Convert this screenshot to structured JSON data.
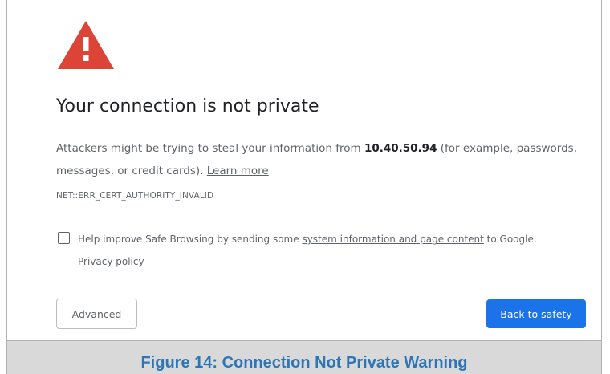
{
  "page": {
    "icon": "warning-triangle-icon",
    "title": "Your connection is not private",
    "message": {
      "before_host": "Attackers might be trying to steal your information from ",
      "host": "10.40.50.94",
      "after_host": " (for example, passwords, messages, or credit cards). ",
      "learn_more": "Learn more"
    },
    "error_code": "NET::ERR_CERT_AUTHORITY_INVALID",
    "safe_browsing": {
      "checked": false,
      "before_link": "Help improve Safe Browsing by sending some ",
      "link": "system information and page content",
      "after_link": " to Google. ",
      "privacy_link": "Privacy policy"
    },
    "buttons": {
      "advanced": "Advanced",
      "back_to_safety": "Back to safety"
    }
  },
  "caption": "Figure 14: Connection Not Private Warning",
  "colors": {
    "warning_red": "#db4437",
    "primary_blue": "#1a73e8",
    "caption_blue": "#2e75b6",
    "caption_bar": "#d9d9d9"
  }
}
